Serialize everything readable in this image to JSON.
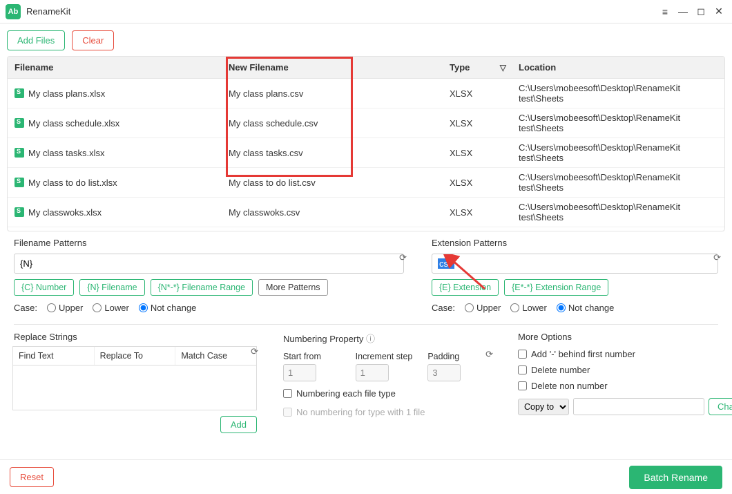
{
  "app": {
    "title": "RenameKit"
  },
  "toolbar": {
    "add_files": "Add Files",
    "clear": "Clear"
  },
  "table": {
    "headers": {
      "filename": "Filename",
      "new_filename": "New Filename",
      "type": "Type",
      "location": "Location"
    },
    "rows": [
      {
        "filename": "My class plans.xlsx",
        "new_filename": "My class plans.csv",
        "type": "XLSX",
        "location": "C:\\Users\\mobeesoft\\Desktop\\RenameKit test\\Sheets"
      },
      {
        "filename": "My class schedule.xlsx",
        "new_filename": "My class schedule.csv",
        "type": "XLSX",
        "location": "C:\\Users\\mobeesoft\\Desktop\\RenameKit test\\Sheets"
      },
      {
        "filename": "My class tasks.xlsx",
        "new_filename": "My class tasks.csv",
        "type": "XLSX",
        "location": "C:\\Users\\mobeesoft\\Desktop\\RenameKit test\\Sheets"
      },
      {
        "filename": "My class to do list.xlsx",
        "new_filename": "My class to do list.csv",
        "type": "XLSX",
        "location": "C:\\Users\\mobeesoft\\Desktop\\RenameKit test\\Sheets"
      },
      {
        "filename": "My classwoks.xlsx",
        "new_filename": "My classwoks.csv",
        "type": "XLSX",
        "location": "C:\\Users\\mobeesoft\\Desktop\\RenameKit test\\Sheets"
      }
    ]
  },
  "filename_patterns": {
    "legend": "Filename Patterns",
    "value": "{N}",
    "tokens": {
      "c_number": "{C} Number",
      "n_filename": "{N} Filename",
      "range": "{N*-*} Filename Range",
      "more": "More Patterns"
    },
    "case_label": "Case:",
    "case_upper": "Upper",
    "case_lower": "Lower",
    "case_nochange": "Not change"
  },
  "extension_patterns": {
    "legend": "Extension Patterns",
    "value": "csv",
    "tokens": {
      "e_ext": "{E} Extension",
      "range": "{E*-*} Extension Range"
    },
    "case_label": "Case:",
    "case_upper": "Upper",
    "case_lower": "Lower",
    "case_nochange": "Not change"
  },
  "replace": {
    "legend": "Replace Strings",
    "find": "Find Text",
    "replace_to": "Replace To",
    "match_case": "Match Case",
    "add": "Add"
  },
  "numbering": {
    "legend": "Numbering Property",
    "start_label": "Start from",
    "start_value": "1",
    "inc_label": "Increment step",
    "inc_value": "1",
    "pad_label": "Padding",
    "pad_value": "3",
    "each_type": "Numbering each file type",
    "no_num_one": "No numbering for type with 1 file"
  },
  "more": {
    "legend": "More Options",
    "dash_first": "Add '-' behind first number",
    "del_num": "Delete number",
    "del_non_num": "Delete non number",
    "copy_to": "Copy to",
    "change": "Change"
  },
  "footer": {
    "reset": "Reset",
    "batch": "Batch Rename"
  }
}
